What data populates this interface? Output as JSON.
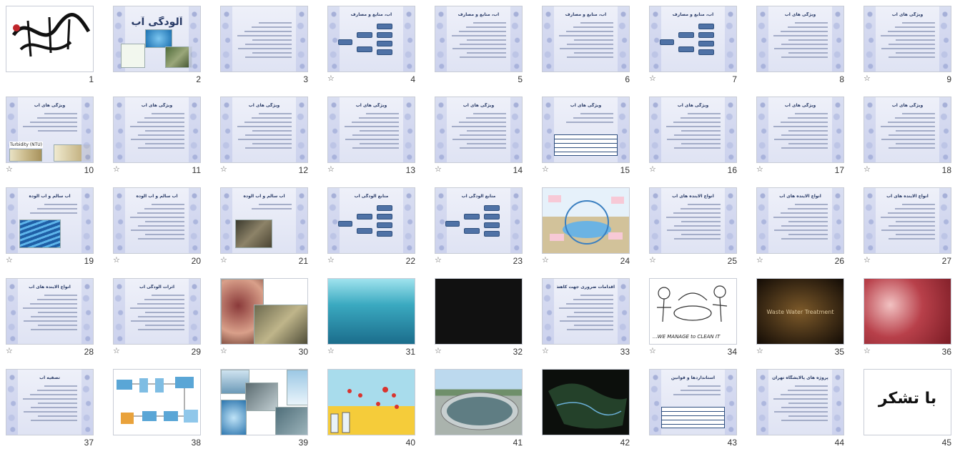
{
  "slides": [
    {
      "n": "1",
      "title": "",
      "kind": "calligraphy",
      "star": false
    },
    {
      "n": "2",
      "title": "آلودگی آب",
      "kind": "cover",
      "star": false
    },
    {
      "n": "3",
      "title": "",
      "kind": "text",
      "star": false
    },
    {
      "n": "4",
      "title": "آب، منابع و مصارف",
      "kind": "diagram",
      "star": true
    },
    {
      "n": "5",
      "title": "آب، منابع و مصارف",
      "kind": "text",
      "star": false
    },
    {
      "n": "6",
      "title": "آب، منابع و مصارف",
      "kind": "text",
      "star": false
    },
    {
      "n": "7",
      "title": "آب، منابع و مصارف",
      "kind": "diagram",
      "star": true
    },
    {
      "n": "8",
      "title": "ویژگی های آب",
      "kind": "text",
      "star": false
    },
    {
      "n": "9",
      "title": "ویژگی های آب",
      "kind": "text",
      "star": true
    },
    {
      "n": "10",
      "title": "ویژگی های آب",
      "kind": "turbidity",
      "star": true
    },
    {
      "n": "11",
      "title": "ویژگی های آب",
      "kind": "text",
      "star": true
    },
    {
      "n": "12",
      "title": "ویژگی های آب",
      "kind": "text",
      "star": true
    },
    {
      "n": "13",
      "title": "ویژگی های آب",
      "kind": "text",
      "star": true
    },
    {
      "n": "14",
      "title": "ویژگی های آب",
      "kind": "text",
      "star": true
    },
    {
      "n": "15",
      "title": "ویژگی های آب",
      "kind": "table",
      "star": true
    },
    {
      "n": "16",
      "title": "ویژگی های آب",
      "kind": "text",
      "star": true
    },
    {
      "n": "17",
      "title": "ویژگی های آب",
      "kind": "text",
      "star": true
    },
    {
      "n": "18",
      "title": "ویژگی های آب",
      "kind": "text",
      "star": true
    },
    {
      "n": "19",
      "title": "آب سالم و آب آلوده",
      "kind": "water",
      "star": true
    },
    {
      "n": "20",
      "title": "آب سالم و آب آلوده",
      "kind": "text",
      "star": true
    },
    {
      "n": "21",
      "title": "آب سالم و آب آلوده",
      "kind": "debris",
      "star": true
    },
    {
      "n": "22",
      "title": "منابع آلودگی آب",
      "kind": "diagram",
      "star": true
    },
    {
      "n": "23",
      "title": "منابع آلودگی آب",
      "kind": "diagram",
      "star": true
    },
    {
      "n": "24",
      "title": "",
      "kind": "watercycle",
      "star": true
    },
    {
      "n": "25",
      "title": "انواع آلاینده های آب",
      "kind": "text",
      "star": true
    },
    {
      "n": "26",
      "title": "انواع آلاینده های آب",
      "kind": "text",
      "star": true
    },
    {
      "n": "27",
      "title": "انواع آلاینده های آب",
      "kind": "text",
      "star": true
    },
    {
      "n": "28",
      "title": "انواع آلاینده های آب",
      "kind": "text",
      "star": true
    },
    {
      "n": "29",
      "title": "اثرات آلودگی آب",
      "kind": "text",
      "star": true
    },
    {
      "n": "30",
      "title": "",
      "kind": "skin",
      "star": true
    },
    {
      "n": "31",
      "title": "",
      "kind": "underwater",
      "star": true
    },
    {
      "n": "32",
      "title": "",
      "kind": "black",
      "star": true
    },
    {
      "n": "33",
      "title": "اقدامات ضروری جهت کاهش آلودگی آب",
      "kind": "text",
      "star": true
    },
    {
      "n": "34",
      "title": "",
      "kind": "cartoon",
      "star": true
    },
    {
      "n": "35",
      "title": "",
      "kind": "dark",
      "star": true
    },
    {
      "n": "36",
      "title": "",
      "kind": "red",
      "star": true
    },
    {
      "n": "37",
      "title": "تصفیه آب",
      "kind": "text",
      "star": false
    },
    {
      "n": "38",
      "title": "",
      "kind": "process",
      "star": false
    },
    {
      "n": "39",
      "title": "",
      "kind": "collage",
      "star": false
    },
    {
      "n": "40",
      "title": "",
      "kind": "lab",
      "star": false
    },
    {
      "n": "41",
      "title": "",
      "kind": "plant",
      "star": false
    },
    {
      "n": "42",
      "title": "",
      "kind": "map",
      "star": false
    },
    {
      "n": "43",
      "title": "استانداردها و قوانین",
      "kind": "table",
      "star": false
    },
    {
      "n": "44",
      "title": "پروژه های پالایشگاه تهران",
      "kind": "text",
      "star": false
    },
    {
      "n": "45",
      "title": "با تشکر",
      "kind": "thanks",
      "star": false
    }
  ],
  "texts": {
    "cover_title": "آلودگی آب",
    "thanks": "با تشکر",
    "turbidity": "Turbidity (NTU)",
    "cartoon": "...WE MANAGE to CLEAN IT",
    "waste": "Waste Water Treatment"
  },
  "star_glyph": "☆",
  "colors": {
    "template_top": "#eef0f9",
    "template_bottom": "#dfe3f3",
    "title": "#283a66",
    "diagram_box": "#4f72a6"
  }
}
